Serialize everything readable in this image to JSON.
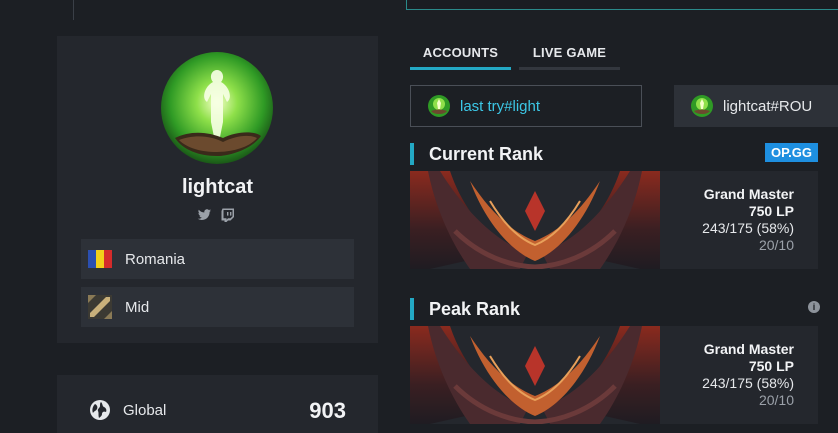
{
  "profile": {
    "name": "lightcat",
    "socials": [
      "twitter-icon",
      "twitch-icon"
    ],
    "country": "Romania",
    "role": "Mid"
  },
  "stats": {
    "label": "Global",
    "value": "903"
  },
  "tabs": [
    {
      "label": "ACCOUNTS",
      "active": true
    },
    {
      "label": "LIVE GAME",
      "active": false
    }
  ],
  "accounts": [
    {
      "label": "last try#light",
      "active": true
    },
    {
      "label": "lightcat#ROU",
      "active": false
    }
  ],
  "current_rank": {
    "title": "Current Rank",
    "source": "OP.GG",
    "tier": "Grand Master",
    "lp": "750 LP",
    "record": "243/175 (58%)",
    "extra": "20/10"
  },
  "peak_rank": {
    "title": "Peak Rank",
    "info_icon": "i",
    "tier": "Grand Master",
    "lp": "750 LP",
    "record": "243/175 (58%)",
    "extra": "20/10"
  },
  "colors": {
    "accent": "#23a8c4",
    "link": "#3cc7e6",
    "opgg": "#1e8fe0",
    "background": "#1c1f24",
    "card": "#24272d"
  }
}
